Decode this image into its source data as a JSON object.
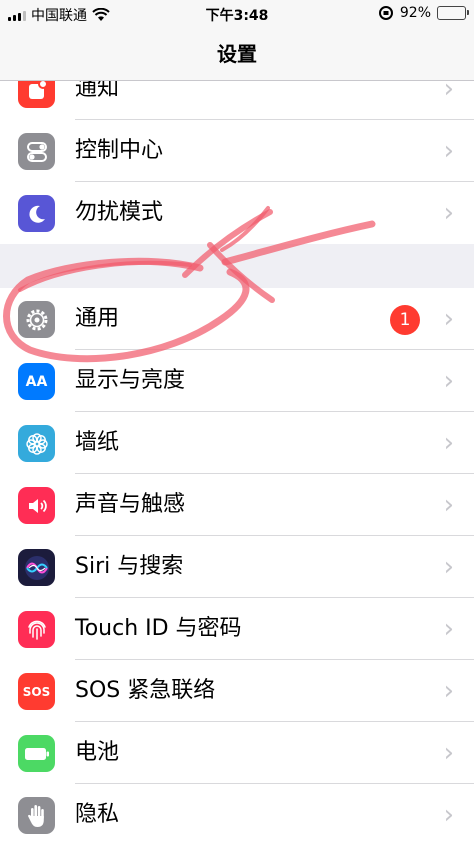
{
  "status": {
    "carrier": "中国联通",
    "time": "下午3:48",
    "battery_percent": "92%",
    "battery_level": 0.92
  },
  "nav": {
    "title": "设置"
  },
  "rows_top": [
    {
      "label": "通知",
      "icon": "notifications-icon",
      "color": "#ff3b30"
    },
    {
      "label": "控制中心",
      "icon": "control-center-icon",
      "color": "#8e8e93"
    },
    {
      "label": "勿扰模式",
      "icon": "moon-icon",
      "color": "#5856d6"
    }
  ],
  "rows_bottom": [
    {
      "label": "通用",
      "icon": "gear-icon",
      "color": "#8e8e93",
      "badge": "1"
    },
    {
      "label": "显示与亮度",
      "icon": "display-brightness-icon",
      "color": "#007aff",
      "glyph": "AA"
    },
    {
      "label": "墙纸",
      "icon": "flower-icon",
      "color": "#34aadc"
    },
    {
      "label": "声音与触感",
      "icon": "speaker-icon",
      "color": "#ff2d55"
    },
    {
      "label": "Siri 与搜索",
      "icon": "siri-icon",
      "color": "#1c1c3c"
    },
    {
      "label": "Touch ID 与密码",
      "icon": "fingerprint-icon",
      "color": "#ff2d55"
    },
    {
      "label": "SOS 紧急联络",
      "icon": "sos-icon",
      "color": "#ff3b30",
      "glyph": "SOS"
    },
    {
      "label": "电池",
      "icon": "battery-icon",
      "color": "#4cd964"
    },
    {
      "label": "隐私",
      "icon": "hand-icon",
      "color": "#8e8e93"
    }
  ]
}
